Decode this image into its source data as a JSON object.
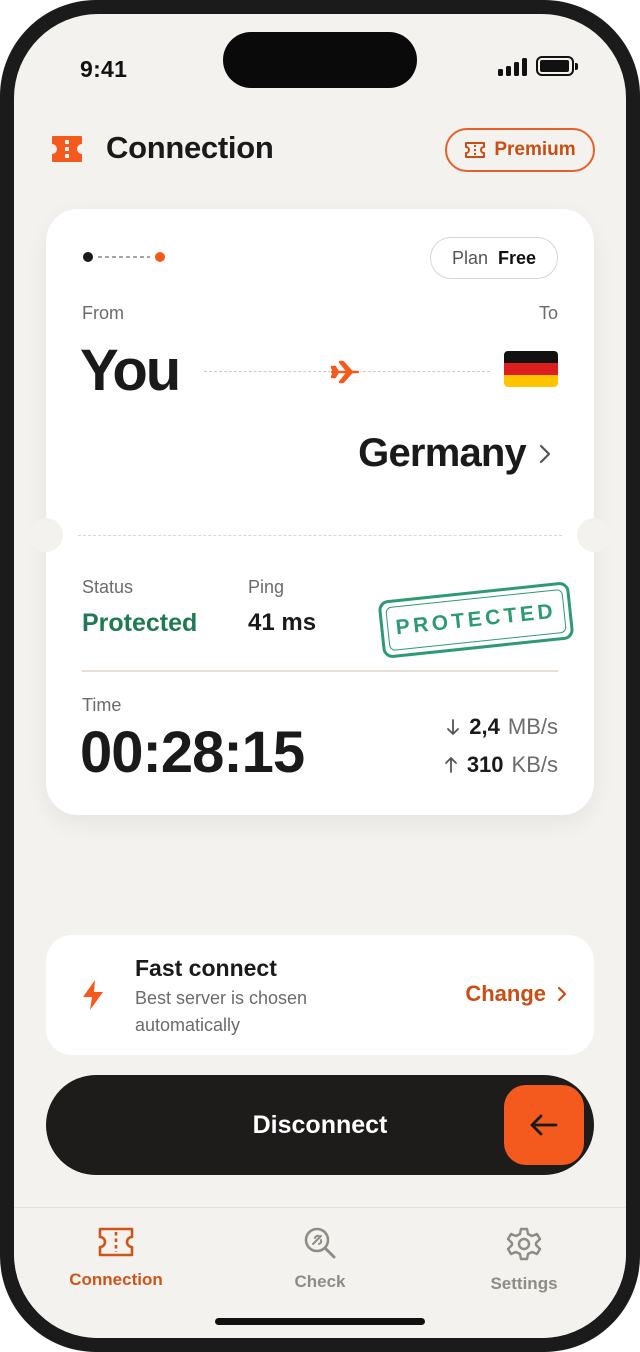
{
  "status_bar": {
    "time": "9:41"
  },
  "header": {
    "title": "Connection",
    "premium_label": "Premium"
  },
  "card": {
    "plan_label": "Plan",
    "plan_value": "Free",
    "from_label": "From",
    "to_label": "To",
    "from_value": "You",
    "destination": "Germany",
    "status_label": "Status",
    "status_value": "Protected",
    "ping_label": "Ping",
    "ping_value": "41 ms",
    "stamp_text": "PROTECTED",
    "time_label": "Time",
    "time_value": "00:28:15",
    "download_value": "2,4",
    "download_unit": "MB/s",
    "upload_value": "310",
    "upload_unit": "KB/s"
  },
  "fast_connect": {
    "title": "Fast connect",
    "subtitle": "Best server is chosen automatically",
    "change_label": "Change"
  },
  "disconnect": {
    "label": "Disconnect"
  },
  "tabs": [
    {
      "label": "Connection",
      "icon": "ticket-icon",
      "active": true
    },
    {
      "label": "Check",
      "icon": "magnifier-icon",
      "active": false
    },
    {
      "label": "Settings",
      "icon": "gear-icon",
      "active": false
    }
  ],
  "colors": {
    "accent": "#f45a1d",
    "accent_text": "#c94e14",
    "protected_green": "#1f7a53",
    "stamp_green": "#2e9a72",
    "background": "#f4f2ee",
    "dark": "#1d1c1b"
  }
}
